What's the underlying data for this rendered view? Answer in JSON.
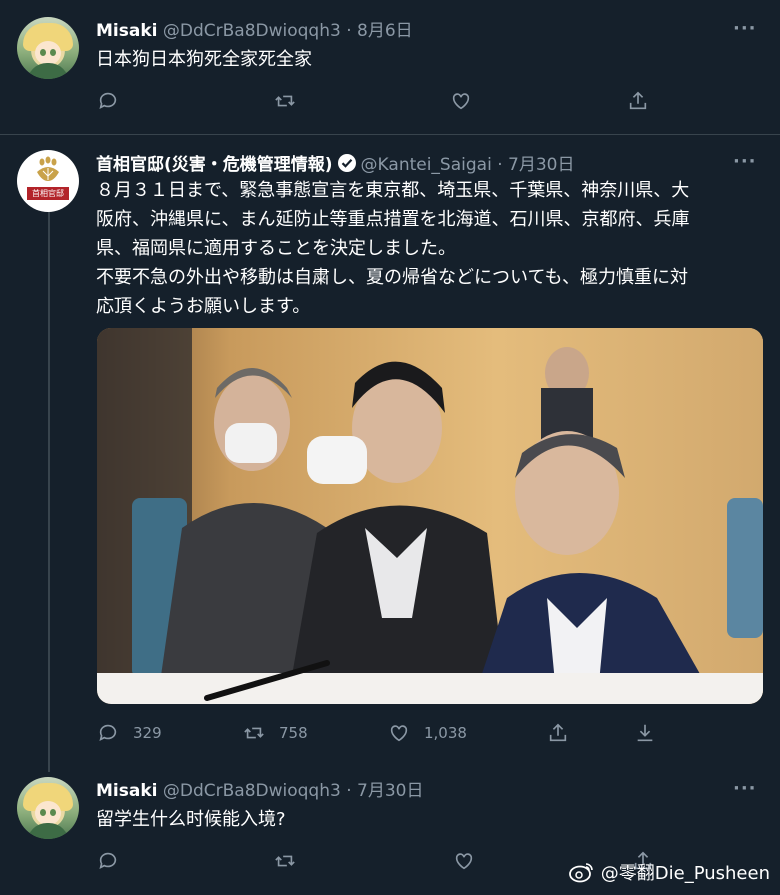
{
  "tweets": [
    {
      "name": "Misaki",
      "handle": "@DdCrBa8Dwioqqh3",
      "separator": "·",
      "date": "8月6日",
      "text": "日本狗日本狗死全家死全家"
    },
    {
      "name": "首相官邸(災害・危機管理情報)",
      "handle": "@Kantei_Saigai",
      "separator": "·",
      "date": "7月30日",
      "text_lines": [
        "８月３１日まで、緊急事態宣言を東京都、埼玉県、千葉県、神奈川県、大",
        "阪府、沖縄県に、まん延防止等重点措置を北海道、石川県、京都府、兵庫",
        "県、福岡県に適用することを決定しました。",
        "不要不急の外出や移動は自粛し、夏の帰省などについても、極力慎重に対",
        "応頂くようお願いします。"
      ],
      "avatar_banner": "首相官邸",
      "reply_count": "329",
      "retweet_count": "758",
      "like_count": "1,038"
    },
    {
      "name": "Misaki",
      "handle": "@DdCrBa8Dwioqqh3",
      "separator": "·",
      "date": "7月30日",
      "text": "留学生什么时候能入境?"
    }
  ],
  "more_label": "···",
  "watermark": "@零翻Die_Pusheen",
  "colors": {
    "background": "#15202b",
    "divider": "#38444d",
    "muted": "#8b98a5",
    "text": "#ffffff",
    "verified": "#ffffff"
  }
}
